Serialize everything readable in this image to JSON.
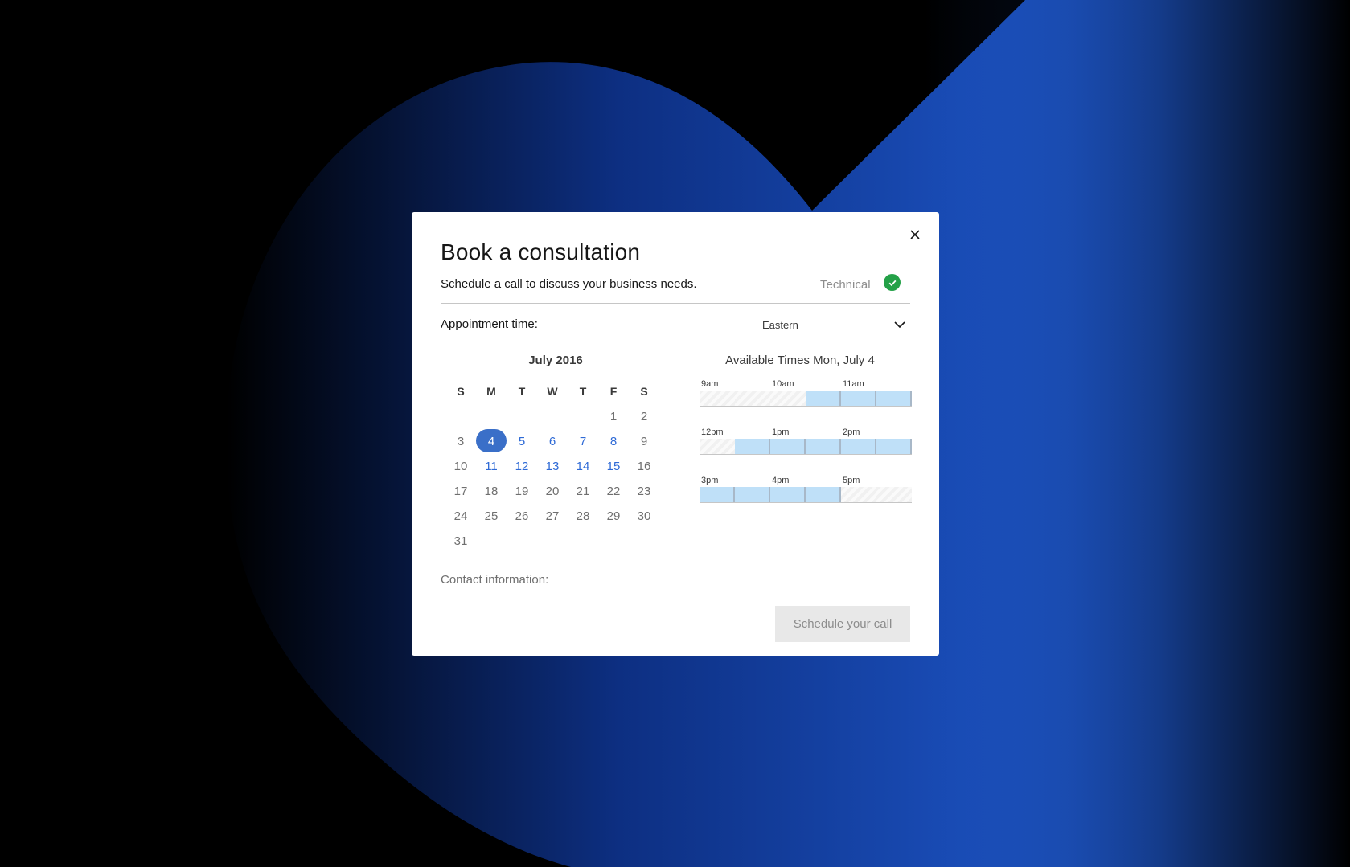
{
  "modal": {
    "title": "Book a consultation",
    "subtitle": "Schedule a call to discuss your business needs.",
    "category": "Technical",
    "close_icon": "close-icon",
    "check_icon": "checkmark-filled-icon"
  },
  "appointment": {
    "label": "Appointment time:",
    "timezone": "Eastern",
    "chevron_icon": "chevron-down-icon"
  },
  "calendar": {
    "month_label": "July 2016",
    "weekdays": [
      "S",
      "M",
      "T",
      "W",
      "T",
      "F",
      "S"
    ],
    "first_weekday_index": 5,
    "days_in_month": 31,
    "available_days": [
      4,
      5,
      6,
      7,
      8,
      11,
      12,
      13,
      14,
      15
    ],
    "selected_day": 4
  },
  "times": {
    "title": "Available Times Mon, July 4",
    "rows": [
      {
        "hours": [
          "9am",
          "10am",
          "11am"
        ],
        "slots": [
          "closed",
          "closed",
          "closed",
          "open",
          "open",
          "open"
        ]
      },
      {
        "hours": [
          "12pm",
          "1pm",
          "2pm"
        ],
        "slots": [
          "closed",
          "open",
          "open",
          "open",
          "open",
          "open"
        ]
      },
      {
        "hours": [
          "3pm",
          "4pm",
          "5pm"
        ],
        "slots": [
          "open",
          "open",
          "open",
          "open",
          "closed",
          "closed"
        ]
      }
    ]
  },
  "contact": {
    "label": "Contact information:"
  },
  "actions": {
    "submit_label": "Schedule your call"
  },
  "colors": {
    "accent": "#3a6fc8",
    "available_slot": "#bfe0f8",
    "success": "#24a148",
    "background_glow": "#1d55c6"
  }
}
